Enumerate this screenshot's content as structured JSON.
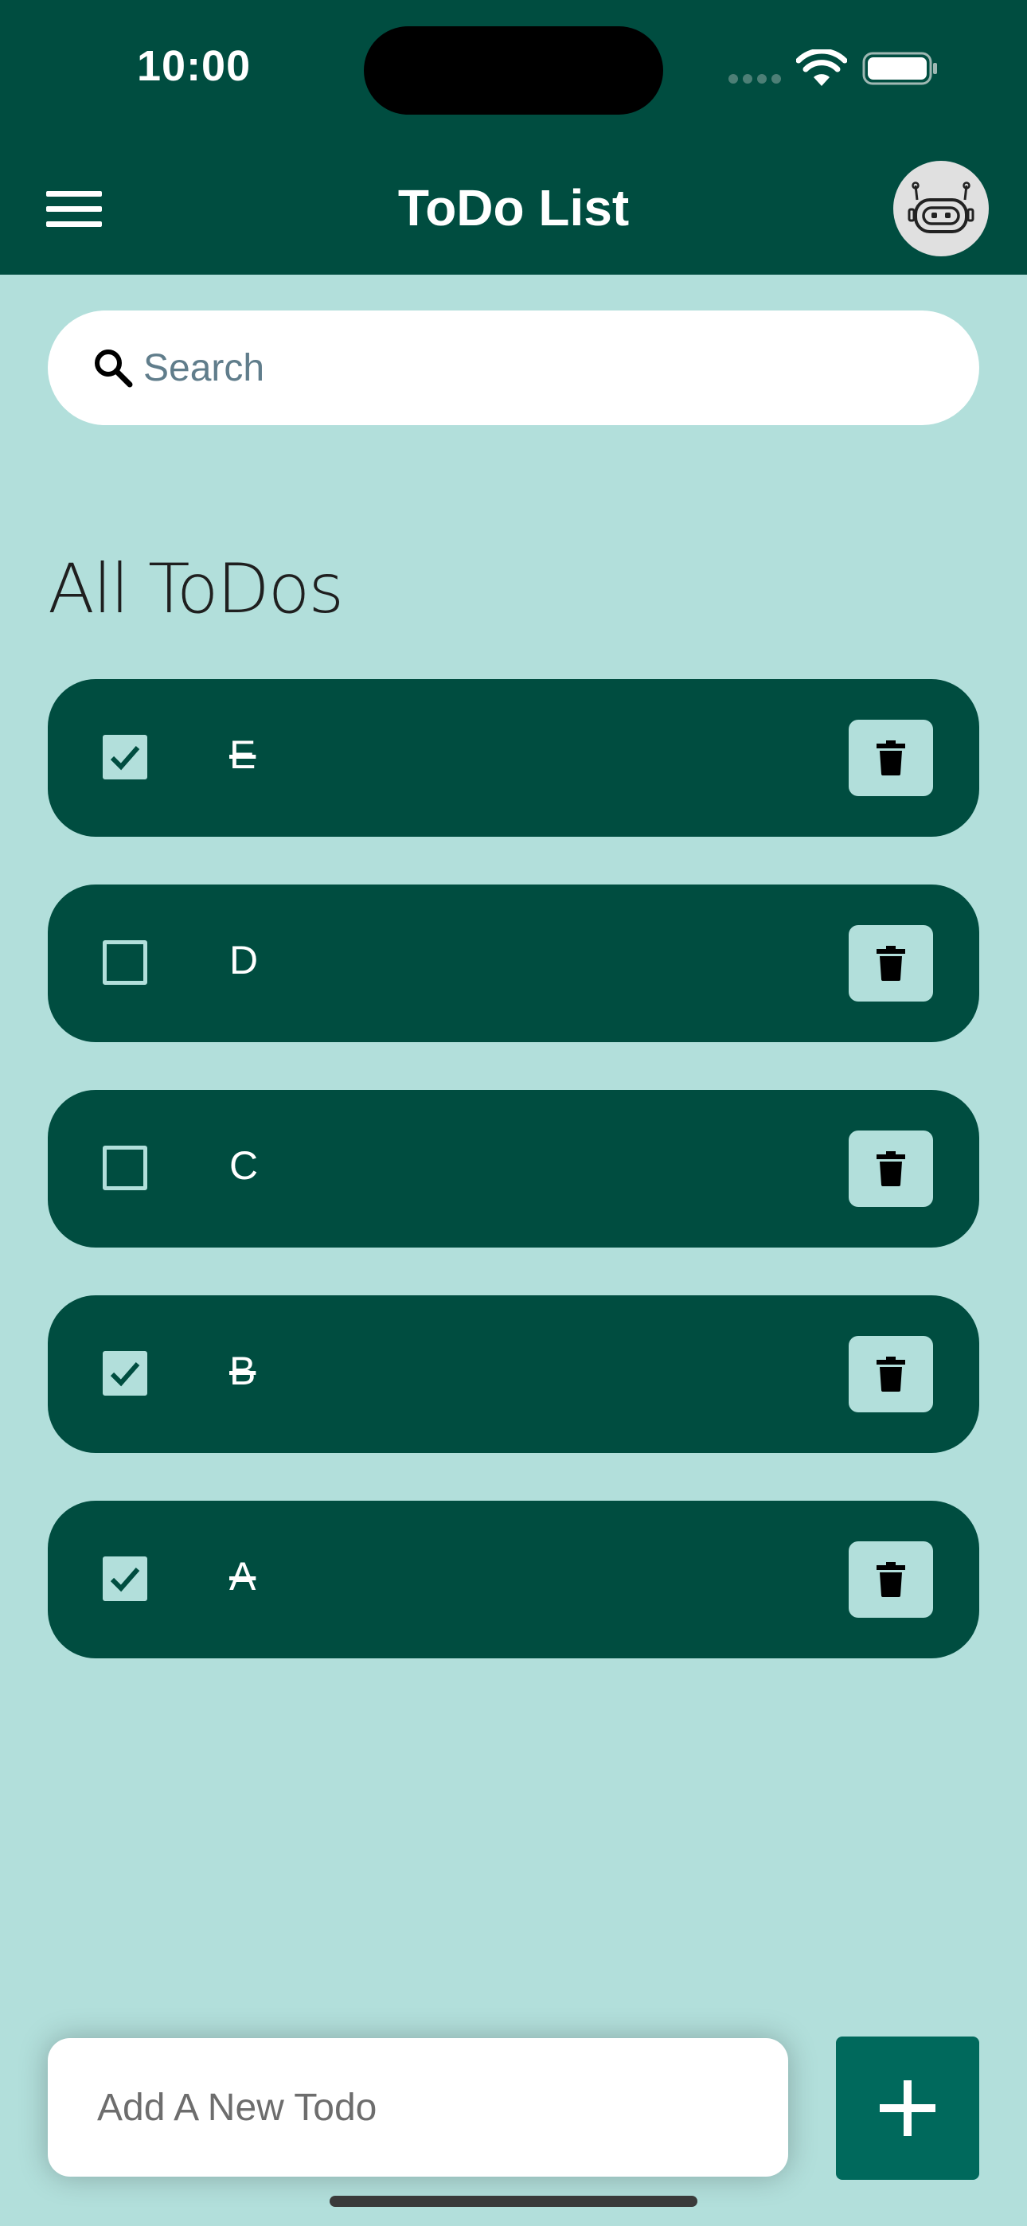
{
  "status_bar": {
    "time": "10:00"
  },
  "header": {
    "title": "ToDo List"
  },
  "search": {
    "placeholder": "Search"
  },
  "section": {
    "title": "All ToDos"
  },
  "todos": [
    {
      "text": "E",
      "done": true
    },
    {
      "text": "D",
      "done": false
    },
    {
      "text": "C",
      "done": false
    },
    {
      "text": "B",
      "done": true
    },
    {
      "text": "A",
      "done": true
    }
  ],
  "new_todo": {
    "placeholder": "Add A New Todo"
  },
  "icons": {
    "menu": "menu-icon",
    "avatar": "robot-icon",
    "search": "search-icon",
    "delete": "trash-icon",
    "add": "plus-icon",
    "checkbox_checked": "check-icon"
  },
  "colors": {
    "header_bg": "#004d40",
    "page_bg": "#b2dfdb",
    "todo_bg": "#004d40",
    "add_button_bg": "#00695c"
  }
}
